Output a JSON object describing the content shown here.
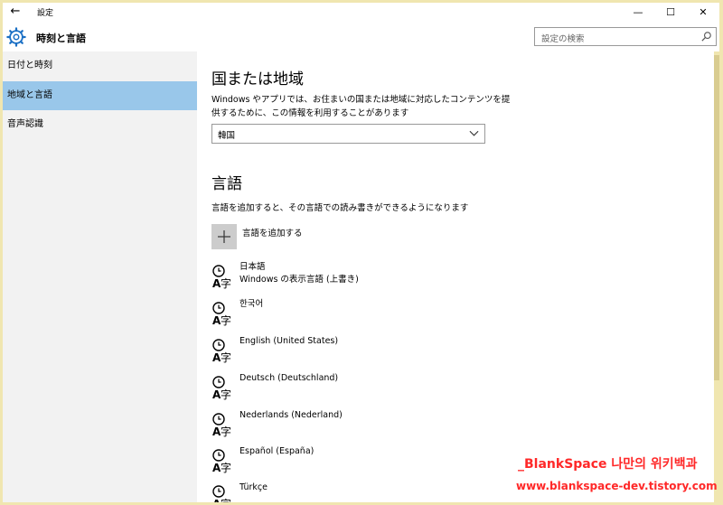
{
  "window": {
    "title": "設定"
  },
  "header": {
    "title": "時刻と言語"
  },
  "search": {
    "placeholder": "設定の検索"
  },
  "sidebar": {
    "items": [
      {
        "label": "日付と時刻"
      },
      {
        "label": "地域と言語",
        "selected": true
      },
      {
        "label": "音声認識"
      }
    ]
  },
  "region": {
    "heading": "国または地域",
    "description_line1": "Windows やアプリでは、お住まいの国または地域に対応したコンテンツを提",
    "description_line2": "供するために、この情報を利用することがあります",
    "selected": "韓国"
  },
  "language": {
    "heading": "言語",
    "description": "言語を追加すると、その言語での読み書きができるようになります",
    "add_label": "言語を追加する",
    "items": [
      {
        "name": "日本語",
        "sub": "Windows の表示言語 (上書き)"
      },
      {
        "name": "한국어"
      },
      {
        "name": "English (United States)"
      },
      {
        "name": "Deutsch (Deutschland)"
      },
      {
        "name": "Nederlands (Nederland)"
      },
      {
        "name": "Español (España)"
      },
      {
        "name": "Türkçe"
      }
    ]
  },
  "watermark": {
    "line1": "_BlankSpace 나만의 위키백과",
    "line2": "www.blankspace-dev.tistory.com"
  },
  "colors": {
    "selected_nav": "#99c7ea",
    "sidebar_bg": "#f2f2f2",
    "frame": "#f0e6b0",
    "watermark": "#ff2828"
  }
}
